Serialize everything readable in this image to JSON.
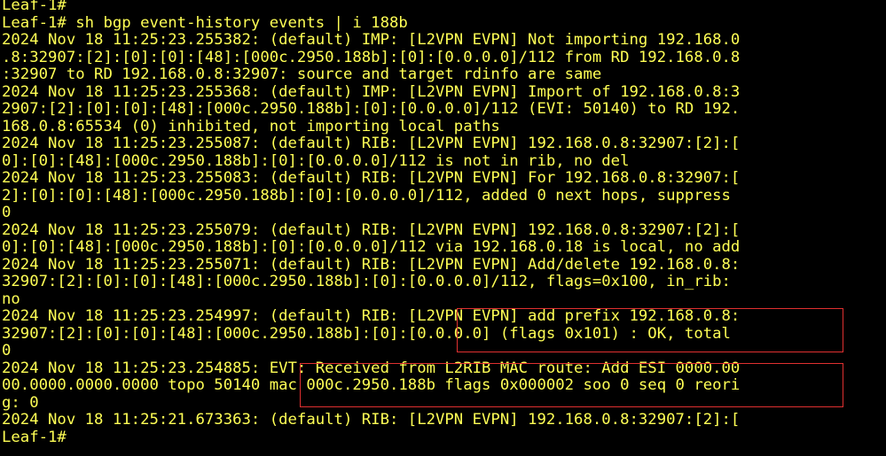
{
  "terminal": {
    "text_color": "#ffff55",
    "background": "#000000",
    "highlight_color": "#e03030",
    "lines": [
      "Leaf-1#",
      "Leaf-1# sh bgp event-history events | i 188b",
      "2024 Nov 18 11:25:23.255382: (default) IMP: [L2VPN EVPN] Not importing 192.168.0",
      ".8:32907:[2]:[0]:[0]:[48]:[000c.2950.188b]:[0]:[0.0.0.0]/112 from RD 192.168.0.8",
      ":32907 to RD 192.168.0.8:32907: source and target rdinfo are same",
      "2024 Nov 18 11:25:23.255368: (default) IMP: [L2VPN EVPN] Import of 192.168.0.8:3",
      "2907:[2]:[0]:[0]:[48]:[000c.2950.188b]:[0]:[0.0.0.0]/112 (EVI: 50140) to RD 192.",
      "168.0.8:65534 (0) inhibited, not importing local paths",
      "2024 Nov 18 11:25:23.255087: (default) RIB: [L2VPN EVPN] 192.168.0.8:32907:[2]:[",
      "0]:[0]:[48]:[000c.2950.188b]:[0]:[0.0.0.0]/112 is not in rib, no del",
      "2024 Nov 18 11:25:23.255083: (default) RIB: [L2VPN EVPN] For 192.168.0.8:32907:[",
      "2]:[0]:[0]:[48]:[000c.2950.188b]:[0]:[0.0.0.0]/112, added 0 next hops, suppress",
      "0",
      "2024 Nov 18 11:25:23.255079: (default) RIB: [L2VPN EVPN] 192.168.0.8:32907:[2]:[",
      "0]:[0]:[48]:[000c.2950.188b]:[0]:[0.0.0.0]/112 via 192.168.0.18 is local, no add",
      "2024 Nov 18 11:25:23.255071: (default) RIB: [L2VPN EVPN] Add/delete 192.168.0.8:",
      "32907:[2]:[0]:[0]:[48]:[000c.2950.188b]:[0]:[0.0.0.0]/112, flags=0x100, in_rib:",
      "no",
      "2024 Nov 18 11:25:23.254997: (default) RIB: [L2VPN EVPN] add prefix 192.168.0.8:",
      "32907:[2]:[0]:[0]:[48]:[000c.2950.188b]:[0]:[0.0.0.0] (flags 0x101) : OK, total",
      "0",
      "2024 Nov 18 11:25:23.254885: EVT: Received from L2RIB MAC route: Add ESI 0000.00",
      "00.0000.0000.0000 topo 50140 mac 000c.2950.188b flags 0x000002 soo 0 seq 0 reori",
      "g: 0",
      "2024 Nov 18 11:25:21.673363: (default) RIB: [L2VPN EVPN] 192.168.0.8:32907:[2]:[",
      "Leaf-1#"
    ]
  }
}
